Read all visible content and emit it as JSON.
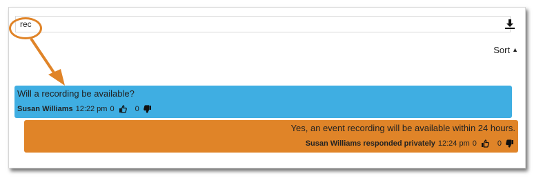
{
  "search": {
    "value": "rec"
  },
  "toolbar": {
    "sort_label": "Sort",
    "sort_caret": "▲",
    "download_icon": "download-icon"
  },
  "messages": [
    {
      "type": "question",
      "text": "Will a recording be available?",
      "author": "Susan Williams",
      "time": "12:22 pm",
      "likes": "0",
      "dislikes": "0"
    },
    {
      "type": "answer",
      "text": "Yes, an event recording will be available within 24 hours.",
      "author": "Susan Williams responded privately",
      "time": "12:24 pm",
      "likes": "0",
      "dislikes": "0"
    }
  ],
  "colors": {
    "question_bg": "#3faee2",
    "answer_bg": "#e08428",
    "annotation": "#e08428"
  }
}
